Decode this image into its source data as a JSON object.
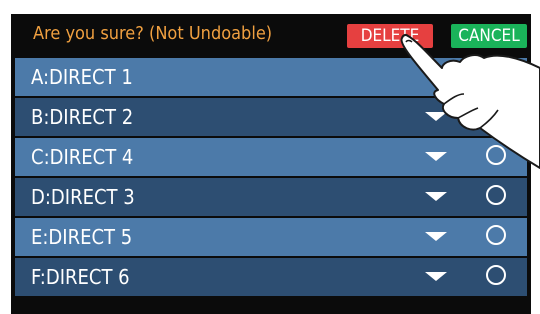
{
  "header": {
    "prompt": "Are you sure?  (Not Undoable)",
    "delete_label": "DELETE",
    "cancel_label": "CANCEL"
  },
  "rows": [
    {
      "label": "A:DIRECT 1",
      "shade": "light"
    },
    {
      "label": "B:DIRECT 2",
      "shade": "dark"
    },
    {
      "label": "C:DIRECT 4",
      "shade": "light"
    },
    {
      "label": "D:DIRECT 3",
      "shade": "dark"
    },
    {
      "label": "E:DIRECT 5",
      "shade": "light"
    },
    {
      "label": "F:DIRECT 6",
      "shade": "dark"
    }
  ],
  "colors": {
    "prompt": "#f0a040",
    "delete": "#e64040",
    "cancel": "#1ab35a",
    "row_light": "#4c7aa9",
    "row_dark": "#2d4e72"
  },
  "icons": {
    "row_menu": "triangle-down-icon",
    "row_select": "radio-circle-icon",
    "pointer": "pointing-hand-icon"
  }
}
